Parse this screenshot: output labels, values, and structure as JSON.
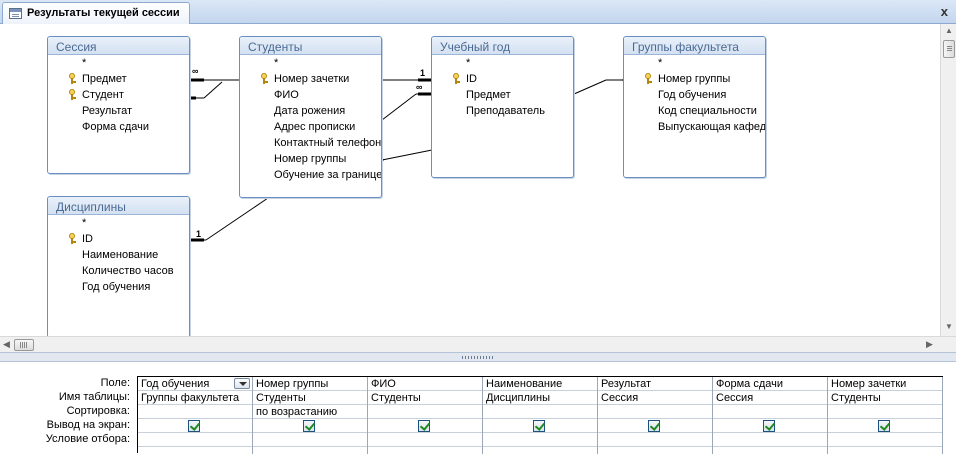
{
  "window": {
    "tab_title": "Результаты текущей сессии",
    "close_glyph": "x"
  },
  "tables": [
    {
      "title": "Сессия",
      "fields": [
        {
          "name": "*",
          "key": false
        },
        {
          "name": "Предмет",
          "key": true
        },
        {
          "name": "Студент",
          "key": true
        },
        {
          "name": "Результат",
          "key": false
        },
        {
          "name": "Форма сдачи",
          "key": false
        }
      ]
    },
    {
      "title": "Студенты",
      "fields": [
        {
          "name": "*",
          "key": false
        },
        {
          "name": "Номер зачетки",
          "key": true
        },
        {
          "name": "ФИО",
          "key": false
        },
        {
          "name": "Дата рожения",
          "key": false
        },
        {
          "name": "Адрес прописки",
          "key": false
        },
        {
          "name": "Контактный телефон",
          "key": false
        },
        {
          "name": "Номер группы",
          "key": false
        },
        {
          "name": "Обучение за границей",
          "key": false
        }
      ]
    },
    {
      "title": "Учебный год",
      "fields": [
        {
          "name": "*",
          "key": false
        },
        {
          "name": "ID",
          "key": true
        },
        {
          "name": "Предмет",
          "key": false
        },
        {
          "name": "Преподаватель",
          "key": false
        }
      ]
    },
    {
      "title": "Группы факультета",
      "fields": [
        {
          "name": "*",
          "key": false
        },
        {
          "name": "Номер группы",
          "key": true
        },
        {
          "name": "Год обучения",
          "key": false
        },
        {
          "name": "Код специальности",
          "key": false
        },
        {
          "name": "Выпускающая кафедра",
          "key": false
        }
      ]
    },
    {
      "title": "Дисциплины",
      "fields": [
        {
          "name": "*",
          "key": false
        },
        {
          "name": "ID",
          "key": true
        },
        {
          "name": "Наименование",
          "key": false
        },
        {
          "name": "Количество часов",
          "key": false
        },
        {
          "name": "Год обучения",
          "key": false
        }
      ]
    }
  ],
  "relationship_labels": {
    "many_1": "∞",
    "one_1": "1",
    "many_2": "∞",
    "one_2": "1"
  },
  "qbe": {
    "row_labels": [
      "Поле:",
      "Имя таблицы:",
      "Сортировка:",
      "Вывод на экран:",
      "Условие отбора:"
    ],
    "columns": [
      {
        "field": "Год обучения",
        "table": "Группы факультета",
        "sort": "",
        "show": true,
        "dropdown": true
      },
      {
        "field": "Номер группы",
        "table": "Студенты",
        "sort": "по возрастанию",
        "show": true,
        "dropdown": false
      },
      {
        "field": "ФИО",
        "table": "Студенты",
        "sort": "",
        "show": true,
        "dropdown": false
      },
      {
        "field": "Наименование",
        "table": "Дисциплины",
        "sort": "",
        "show": true,
        "dropdown": false
      },
      {
        "field": "Результат",
        "table": "Сессия",
        "sort": "",
        "show": true,
        "dropdown": false
      },
      {
        "field": "Форма сдачи",
        "table": "Сессия",
        "sort": "",
        "show": true,
        "dropdown": false
      },
      {
        "field": "Номер зачетки",
        "table": "Студенты",
        "sort": "",
        "show": true,
        "dropdown": false
      }
    ]
  },
  "colors": {
    "table_border": "#6b8fbf",
    "table_title_text": "#4a6a93",
    "check_green": "#1f8a1f"
  }
}
